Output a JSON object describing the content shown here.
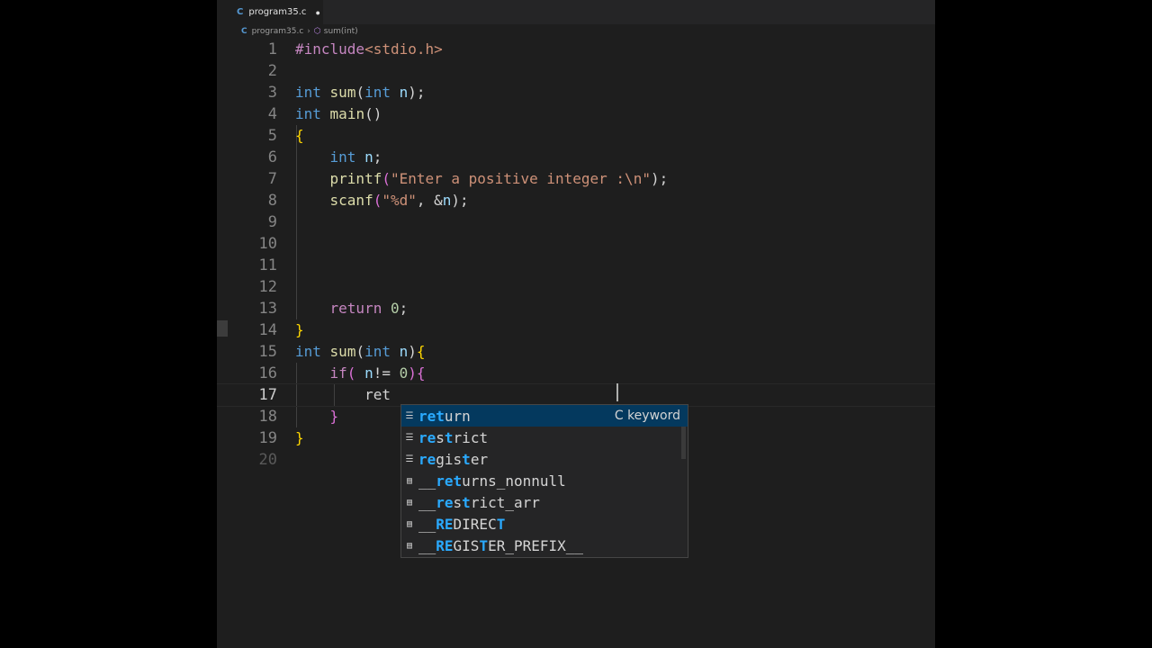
{
  "tab": {
    "label": "program35.c",
    "dirty": "●",
    "lang": "C"
  },
  "breadcrumb": {
    "file": "program35.c",
    "sep": "›",
    "symbol": "sum(int)",
    "lang": "C"
  },
  "lines": [
    {
      "n": "1"
    },
    {
      "n": "2"
    },
    {
      "n": "3"
    },
    {
      "n": "4"
    },
    {
      "n": "5"
    },
    {
      "n": "6"
    },
    {
      "n": "7"
    },
    {
      "n": "8"
    },
    {
      "n": "9"
    },
    {
      "n": "10"
    },
    {
      "n": "11"
    },
    {
      "n": "12"
    },
    {
      "n": "13"
    },
    {
      "n": "14"
    },
    {
      "n": "15"
    },
    {
      "n": "16"
    },
    {
      "n": "17"
    },
    {
      "n": "18"
    },
    {
      "n": "19"
    },
    {
      "n": "20"
    }
  ],
  "code": {
    "l1": {
      "a": "#include",
      "b": "<stdio.h>"
    },
    "l3": {
      "kw": "int",
      "fn": "sum",
      "p1": "(",
      "kw2": "int",
      "var": "n",
      "p2": ");"
    },
    "l4": {
      "kw": "int",
      "fn": "main",
      "p": "()"
    },
    "l5": {
      "b": "{"
    },
    "l6": {
      "kw": "int",
      "var": "n",
      "p": ";"
    },
    "l7": {
      "fn": "printf",
      "p1": "(",
      "str": "\"Enter a positive integer :\\n\"",
      "p2": ");"
    },
    "l8": {
      "fn": "scanf",
      "p1": "(",
      "str": "\"%d\"",
      "p2": ", &",
      "var": "n",
      "p3": ");"
    },
    "l13": {
      "ctrl": "return",
      "num": "0",
      "p": ";"
    },
    "l14": {
      "b": "}"
    },
    "l15": {
      "kw": "int",
      "fn": "sum",
      "p1": "(",
      "kw2": "int",
      "var": "n",
      "p2": ")",
      "b": "{"
    },
    "l16": {
      "ctrl": "if",
      "p1": "( ",
      "var": "n",
      "p2": "!= ",
      "num": "0",
      "p3": ")",
      "b": "{"
    },
    "l17": {
      "typed": "ret"
    },
    "l18": {
      "b": "}"
    },
    "l19": {
      "b": "}"
    }
  },
  "suggest": {
    "detail": "C keyword",
    "items": [
      {
        "icon": "keyword-icon",
        "m1": "ret",
        "rest": "urn"
      },
      {
        "icon": "keyword-icon",
        "m1": "re",
        "mid": "s",
        "m2": "t",
        "rest": "rict"
      },
      {
        "icon": "keyword-icon",
        "m1": "re",
        "mid": "gis",
        "m2": "t",
        "rest": "er"
      },
      {
        "icon": "snippet-icon",
        "pre": "__",
        "m1": "ret",
        "rest": "urns_nonnull"
      },
      {
        "icon": "snippet-icon",
        "pre": "__",
        "m1": "re",
        "mid": "s",
        "m2": "t",
        "rest": "rict_arr"
      },
      {
        "icon": "snippet-icon",
        "pre": "__",
        "m1": "RE",
        "mid": "DIREC",
        "m2": "T",
        "rest": ""
      },
      {
        "icon": "snippet-icon",
        "pre": "__",
        "m1": "RE",
        "mid": "GIS",
        "m2": "T",
        "rest": "ER_PREFIX__"
      }
    ]
  }
}
